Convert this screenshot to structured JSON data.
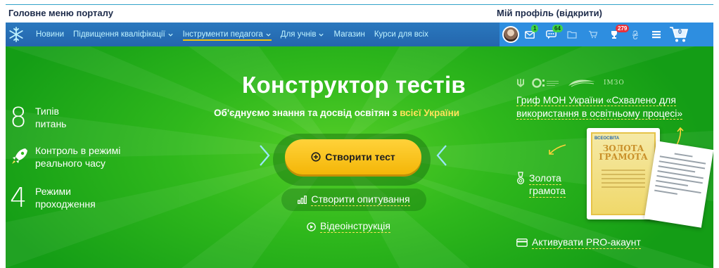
{
  "annotations": {
    "main_menu_label": "Головне меню порталу",
    "profile_label": "Мій профіль (відкрити)"
  },
  "nav": {
    "logo": "snowflake-icon",
    "items": [
      {
        "label": "Новини",
        "has_dropdown": false
      },
      {
        "label": "Підвищення кваліфікації",
        "has_dropdown": true
      },
      {
        "label": "Інструменти педагога",
        "has_dropdown": true,
        "active": true
      },
      {
        "label": "Для учнів",
        "has_dropdown": true
      },
      {
        "label": "Магазин",
        "has_dropdown": false
      },
      {
        "label": "Курси для всіх",
        "has_dropdown": false
      }
    ]
  },
  "profile": {
    "messages_badge": "1",
    "chat_badge": "64",
    "notifications_badge": "279",
    "cart_count": "0"
  },
  "hero": {
    "title": "Конструктор тестів",
    "subtitle_prefix": "Об'єднуємо знання та досвід освітян з ",
    "subtitle_highlight": "всієї України",
    "features": [
      {
        "num": "8",
        "text_line1": "Типів",
        "text_line2": "питань"
      },
      {
        "num": "",
        "text_line1": "Контроль в режимі",
        "text_line2": "реального часу"
      },
      {
        "num": "4",
        "text_line1": "Режими",
        "text_line2": "проходження"
      }
    ],
    "create_test_label": "Створити тест",
    "create_poll_label": "Створити опитування",
    "video_label": "Відеоінструкція"
  },
  "sidebar_right": {
    "partner_text": "ІМЗО",
    "grif_text": "Гриф МОН України «Схвалено для використання в освітньому процесі»",
    "gold_line1": "Золота",
    "gold_line2": "грамота",
    "certificate_brand": "ВСЕОСВІТА",
    "certificate_title_line1": "ЗОЛОТА",
    "certificate_title_line2": "ГРАМОТА",
    "pro_label": "Активувати PRO-акаунт"
  },
  "colors": {
    "nav_bg": "#2466ad",
    "profile_bg": "#2e8ee0",
    "hero_green": "#2fb81c",
    "button_yellow": "#f4b608",
    "accent_yellow": "#ffe35a"
  }
}
